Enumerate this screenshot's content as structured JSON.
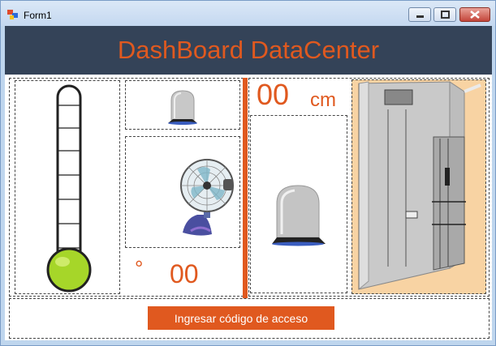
{
  "window": {
    "title": "Form1"
  },
  "header": {
    "title": "DashBoard DataCenter"
  },
  "temperature": {
    "symbol": "°",
    "value": "00"
  },
  "distance": {
    "value": "00",
    "unit": "cm"
  },
  "access_button": {
    "label": "Ingresar código de acceso"
  },
  "colors": {
    "accent": "#e0591f",
    "header_bg": "#344358",
    "room_bg": "#f8d3a3",
    "thermo_fill": "#a6d629"
  },
  "icons": [
    "form-icon",
    "minimize-icon",
    "maximize-icon",
    "close-icon",
    "thermometer-icon",
    "bell-jar-icon",
    "fan-icon",
    "room-3d-icon"
  ]
}
